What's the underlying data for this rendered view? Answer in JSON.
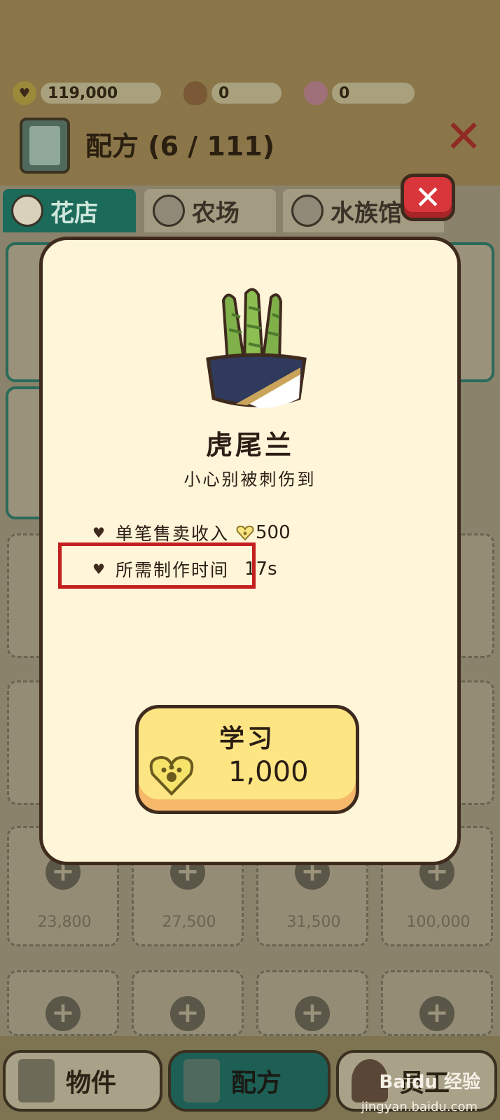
{
  "currencies": [
    {
      "icon": "paw-heart-icon",
      "value": "119,000"
    },
    {
      "icon": "acorn-icon",
      "value": "0"
    },
    {
      "icon": "shell-icon",
      "value": "0"
    }
  ],
  "header": {
    "title": "配方 (6 / 111)"
  },
  "tabs": [
    {
      "label": "花店",
      "icon": "flower-icon"
    },
    {
      "label": "农场",
      "icon": "watering-can-icon"
    },
    {
      "label": "水族馆",
      "icon": "fishbowl-icon"
    }
  ],
  "background_cards": {
    "prices": [
      "23,800",
      "27,500",
      "31,500",
      "100,000"
    ]
  },
  "bottom_nav": [
    {
      "label": "物件",
      "icon": "chair-icon"
    },
    {
      "label": "配方",
      "icon": "recipe-book-icon"
    },
    {
      "label": "员工",
      "icon": "staff-cat-icon"
    }
  ],
  "watermark": {
    "text": "Baidu 经验",
    "sub": "jingyan.baidu.com"
  },
  "modal": {
    "plant_name": "虎尾兰",
    "description": "小心别被刺伤到",
    "stats": [
      {
        "label": "单笔售卖收入",
        "value": "500",
        "icon": "paw-heart-icon"
      },
      {
        "label": "所需制作时间",
        "value": "17s"
      }
    ],
    "learn_button": {
      "label": "学习",
      "price": "1,000"
    }
  },
  "colors": {
    "accent_teal": "#1b6a5a",
    "modal_bg": "#fff5d9",
    "button_yellow": "#fde583",
    "close_red": "#d8363a",
    "highlight_red": "#c41f1f"
  }
}
